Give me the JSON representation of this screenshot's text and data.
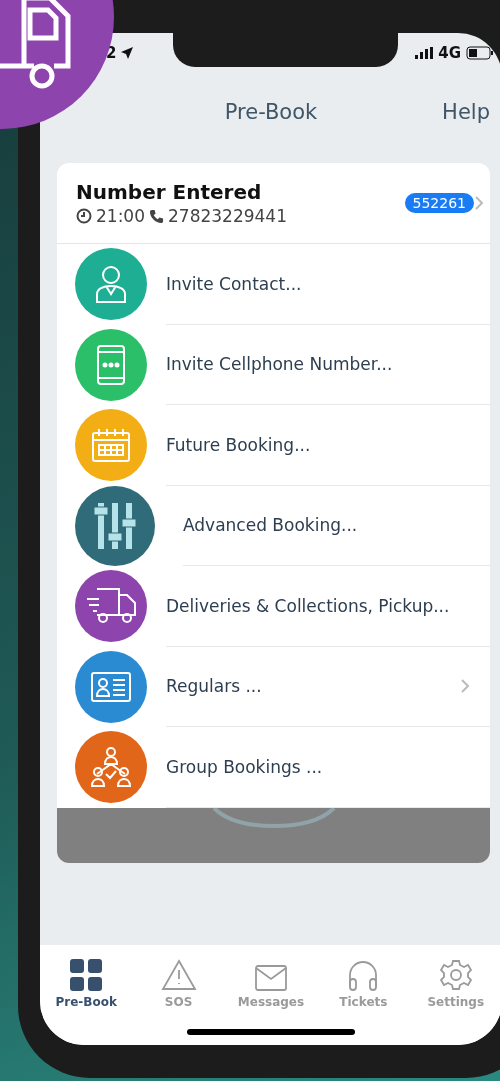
{
  "status_bar": {
    "time": "2",
    "network": "4G"
  },
  "nav": {
    "title": "Pre-Book",
    "action": "Help"
  },
  "card": {
    "title": "Number Entered",
    "time": "21:00",
    "phone": "27823229441",
    "badge": "552261"
  },
  "menu": [
    {
      "label": "Invite Contact...",
      "color": "#1eae94",
      "chevron": false
    },
    {
      "label": "Invite Cellphone Number...",
      "color": "#2cbf6a",
      "chevron": false
    },
    {
      "label": "Future Booking...",
      "color": "#f2ae14",
      "chevron": false
    },
    {
      "label": "Advanced Booking...",
      "color": "#2f6b78",
      "chevron": false
    },
    {
      "label": "Deliveries & Collections, Pickup...",
      "color": "#8e44ad",
      "chevron": false
    },
    {
      "label": "Regulars ...",
      "color": "#2a8ad2",
      "chevron": true
    },
    {
      "label": "Group Bookings ...",
      "color": "#e2661a",
      "chevron": false
    }
  ],
  "tabs": [
    {
      "label": "Pre-Book",
      "selected": true
    },
    {
      "label": "SOS",
      "selected": false
    },
    {
      "label": "Messages",
      "selected": false
    },
    {
      "label": "Tickets",
      "selected": false
    },
    {
      "label": "Settings",
      "selected": false
    }
  ]
}
